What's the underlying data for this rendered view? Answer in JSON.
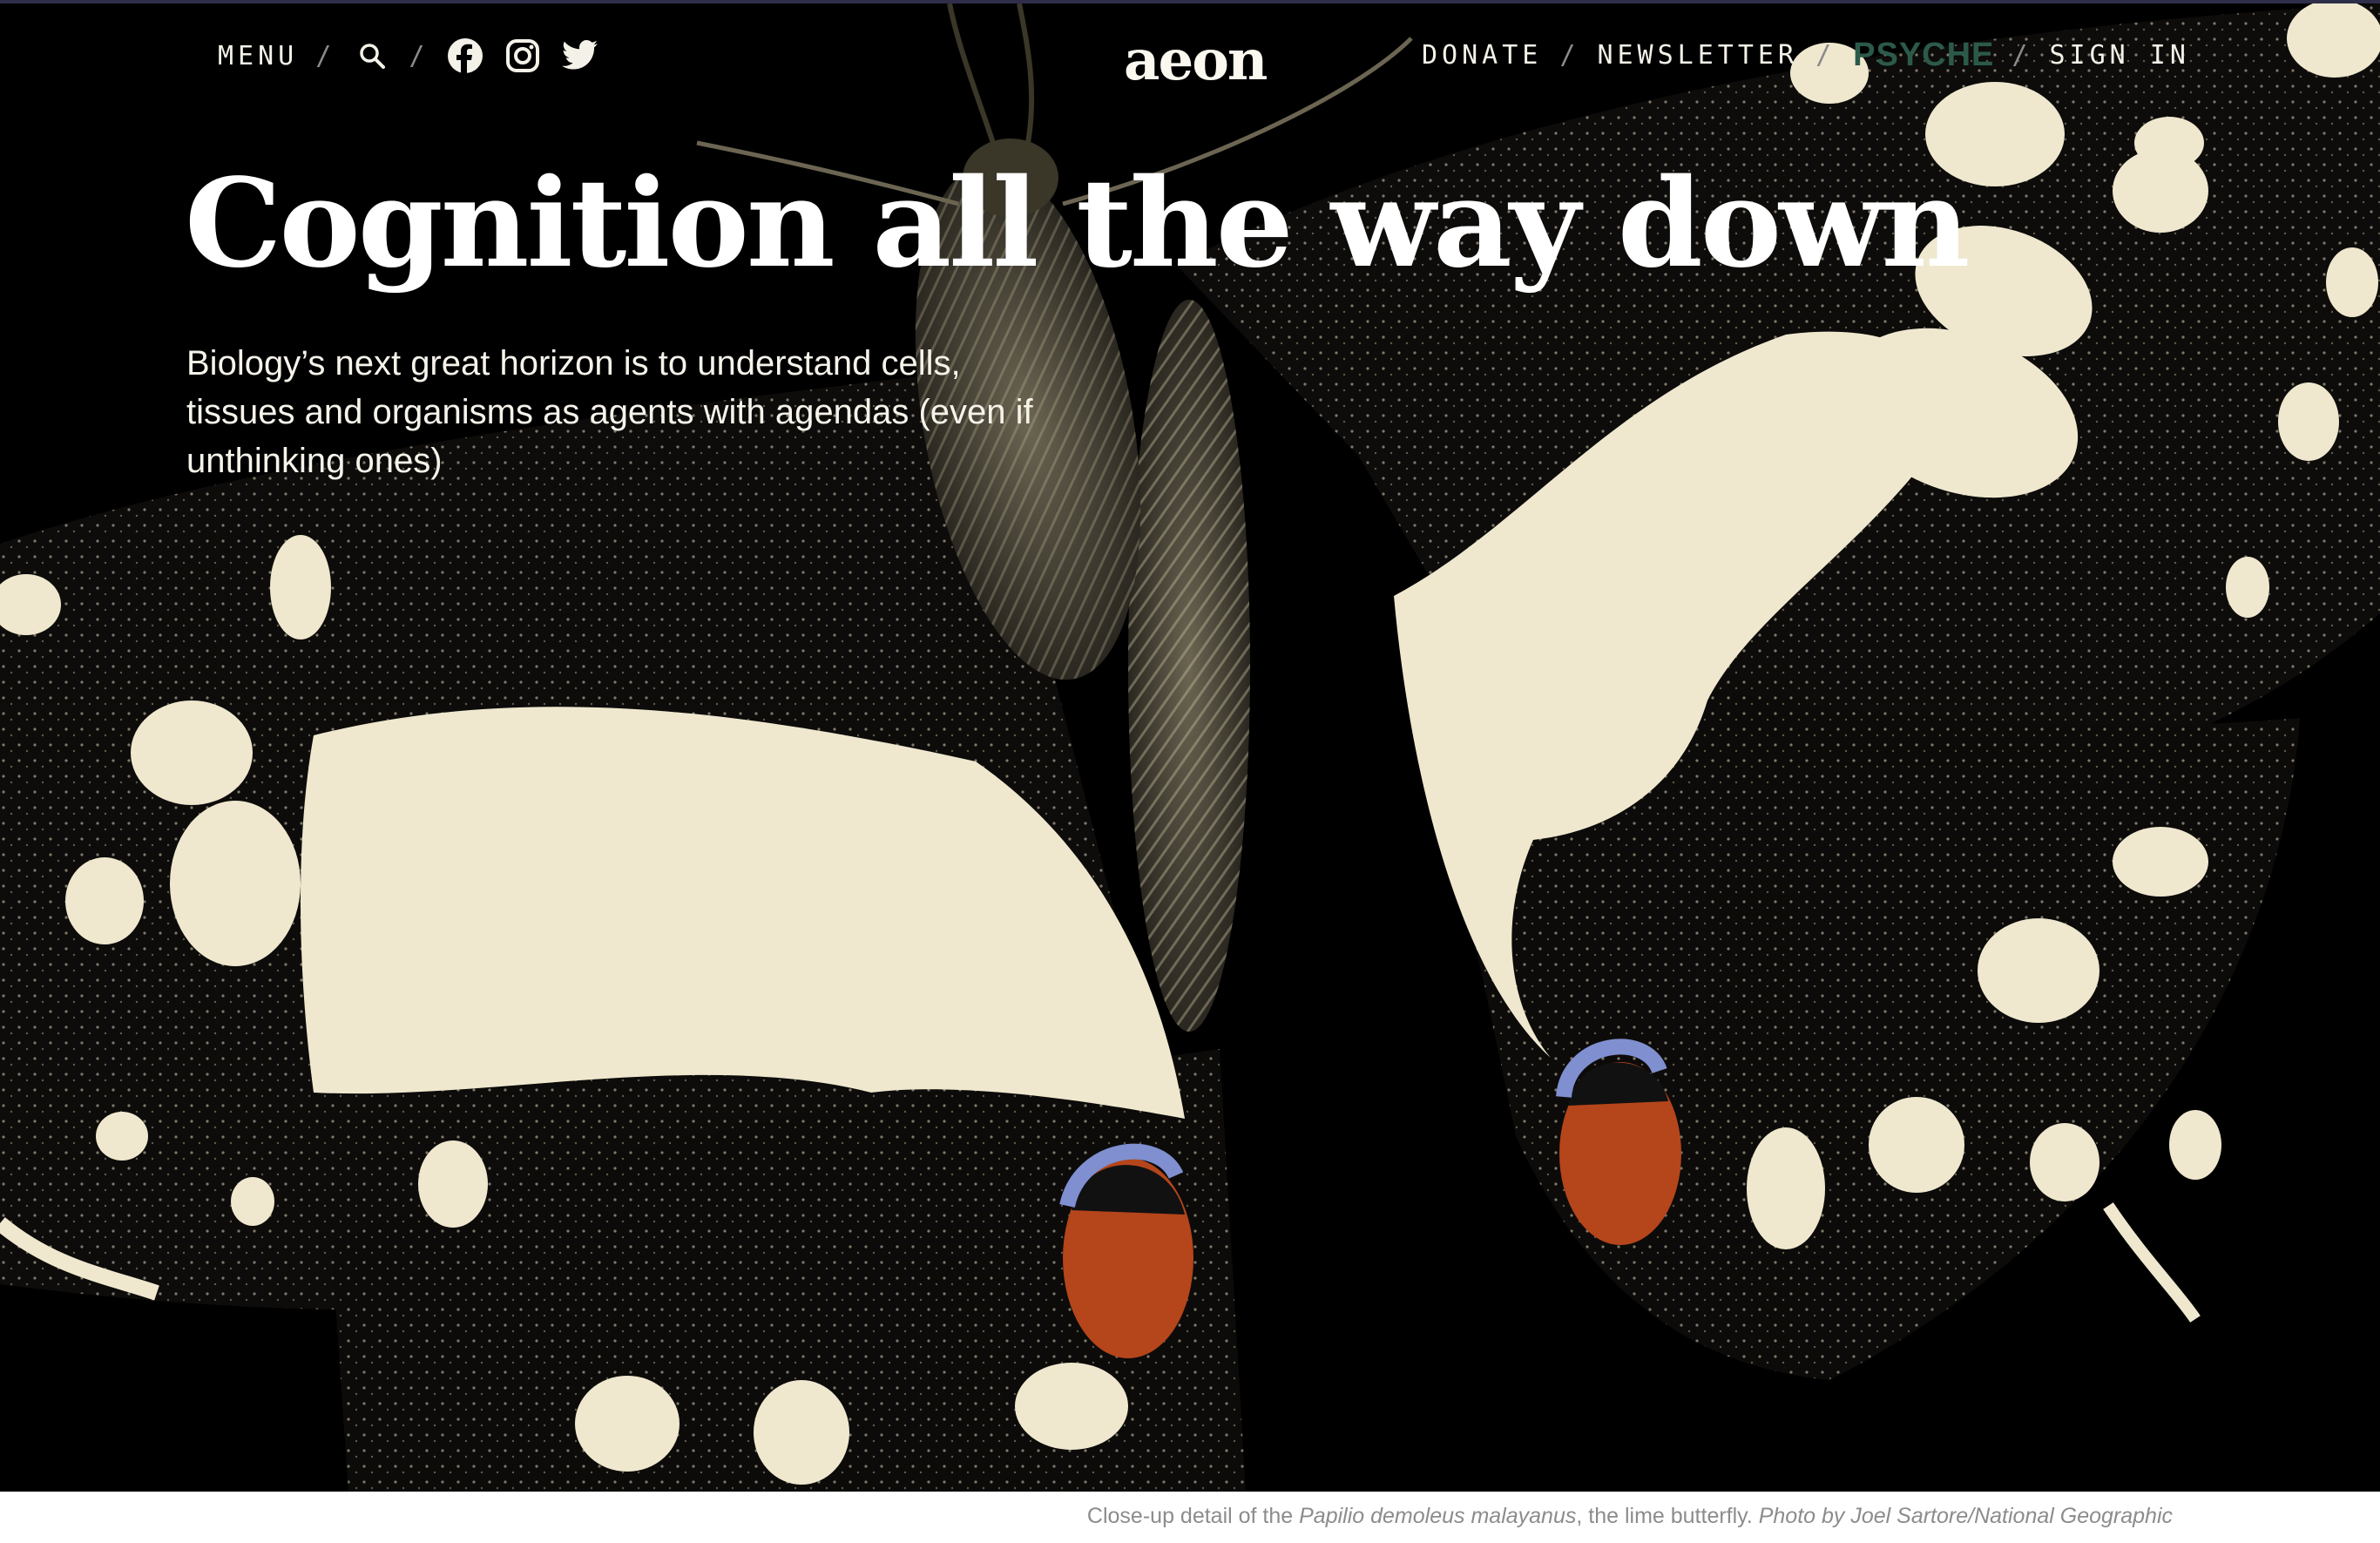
{
  "nav": {
    "menu_label": "MENU",
    "separator": "/",
    "donate_label": "DONATE",
    "newsletter_label": "NEWSLETTER",
    "psyche_label": "PSYCHE",
    "signin_label": "SIGN IN",
    "logo": "aeon",
    "icons": [
      "search-icon",
      "facebook-icon",
      "instagram-icon",
      "twitter-icon"
    ]
  },
  "article": {
    "title": "Cognition all the way down",
    "subtitle": "Biology’s next great horizon is to understand cells, tissues and organisms as agents with agendas (even if unthinking ones)"
  },
  "caption": {
    "prefix": "Close-up detail of the ",
    "species": "Papilio demoleus malayanus",
    "middle": ", the lime butterfly. ",
    "credit": "Photo by Joel Sartore/National Geographic"
  },
  "colors": {
    "background": "#000000",
    "wing_cream": "#efe8cf",
    "eyespot_blue": "#7f8fd0",
    "eyespot_orange": "#b5451b",
    "psyche_green": "#2c5a4a"
  }
}
